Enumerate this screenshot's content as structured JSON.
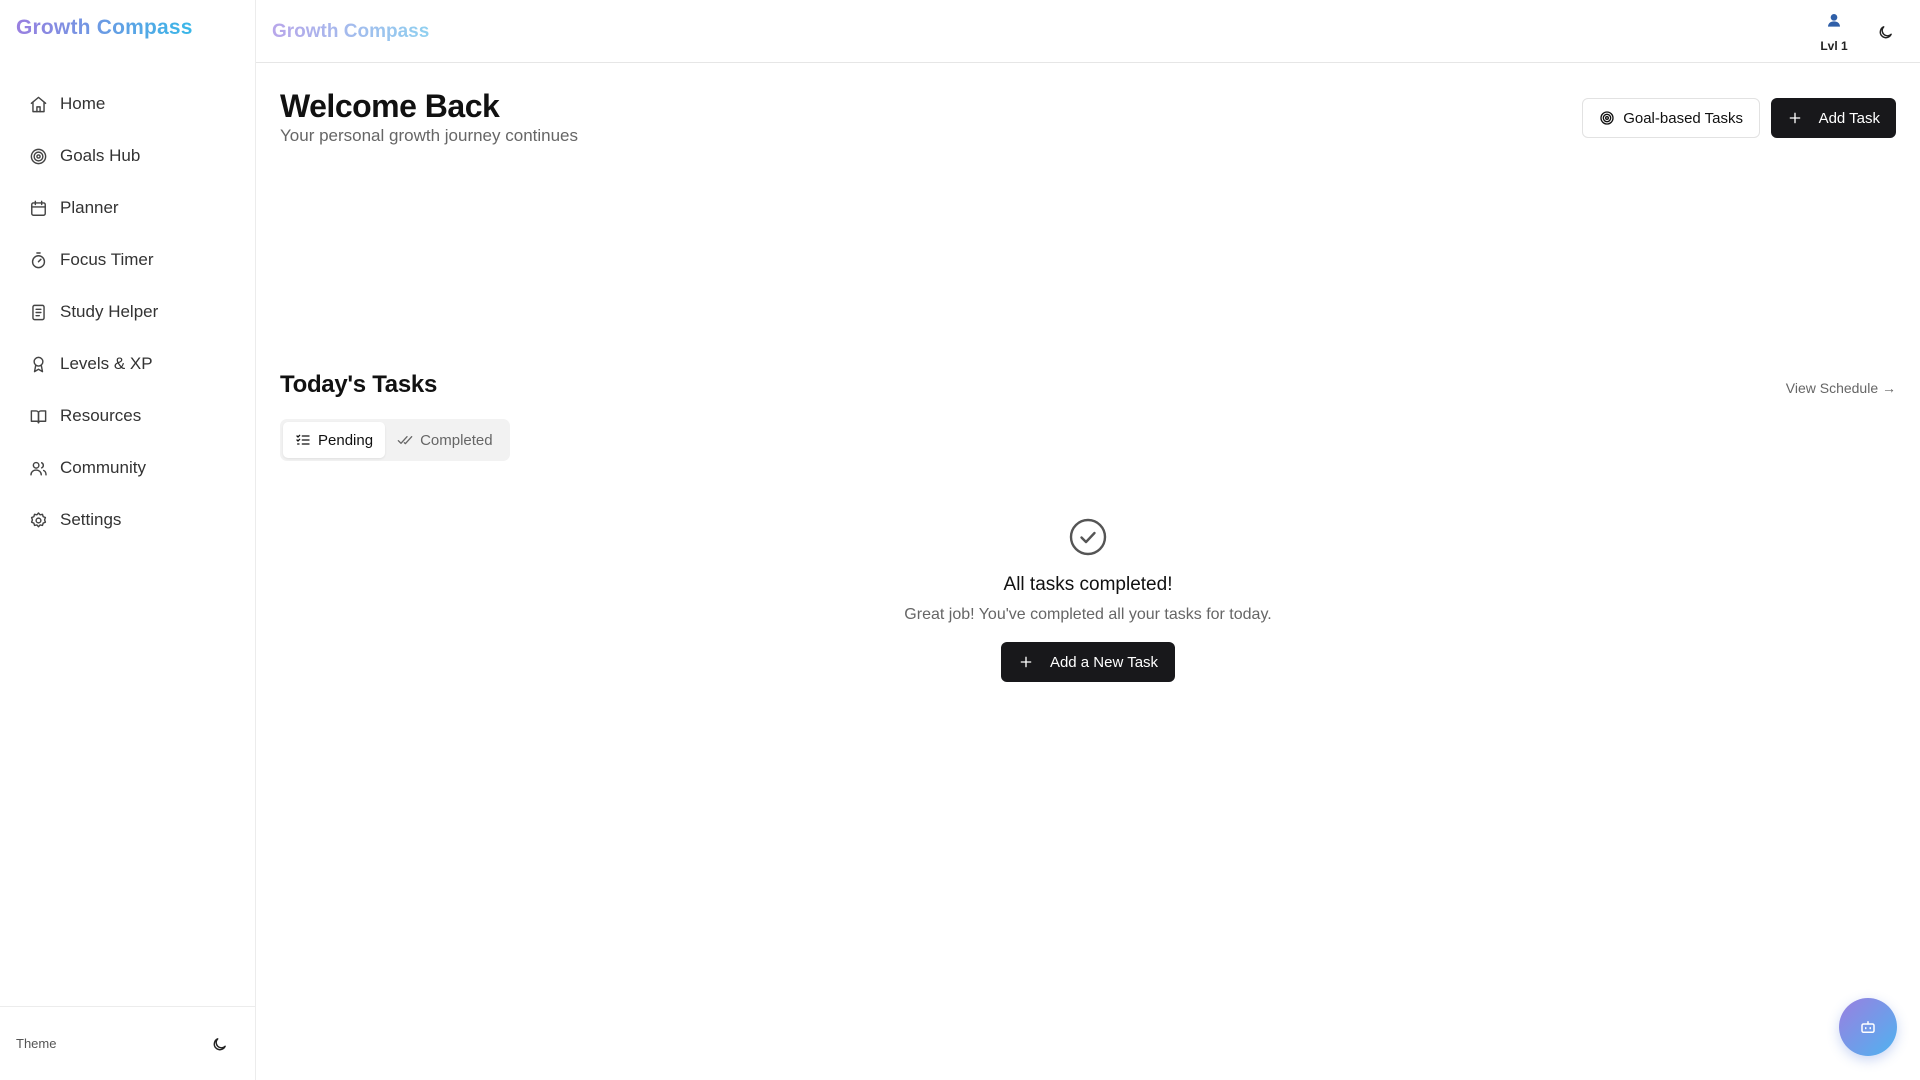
{
  "app": {
    "name": "Growth Compass"
  },
  "sidebar": {
    "items": [
      {
        "label": "Home",
        "icon": "home-icon"
      },
      {
        "label": "Goals Hub",
        "icon": "target-icon"
      },
      {
        "label": "Planner",
        "icon": "calendar-icon"
      },
      {
        "label": "Focus Timer",
        "icon": "timer-icon"
      },
      {
        "label": "Study Helper",
        "icon": "notebook-icon"
      },
      {
        "label": "Levels & XP",
        "icon": "award-icon"
      },
      {
        "label": "Resources",
        "icon": "book-icon"
      },
      {
        "label": "Community",
        "icon": "users-icon"
      },
      {
        "label": "Settings",
        "icon": "gear-icon"
      }
    ],
    "theme_label": "Theme"
  },
  "topbar": {
    "title": "Growth Compass",
    "level_label": "Lvl 1",
    "profile_icon": "user-icon"
  },
  "main": {
    "welcome_title": "Welcome Back",
    "welcome_subtitle": "Your personal growth journey continues",
    "goal_tasks_label": "Goal-based Tasks",
    "add_task_label": "Add Task",
    "tasks_title": "Today's Tasks",
    "view_schedule_label": "View Schedule →",
    "tabs": [
      {
        "label": "Pending",
        "icon": "list-check-icon",
        "active": true
      },
      {
        "label": "Completed",
        "icon": "check-check-icon",
        "active": false
      }
    ],
    "empty_state": {
      "title": "All tasks completed!",
      "message": "Great job! You've completed all your tasks for today.",
      "button_label": "Add a New Task"
    }
  },
  "colors": {
    "brand_from": "#9a7fe0",
    "brand_to": "#38b8e8",
    "primary_button": "#18181b"
  }
}
